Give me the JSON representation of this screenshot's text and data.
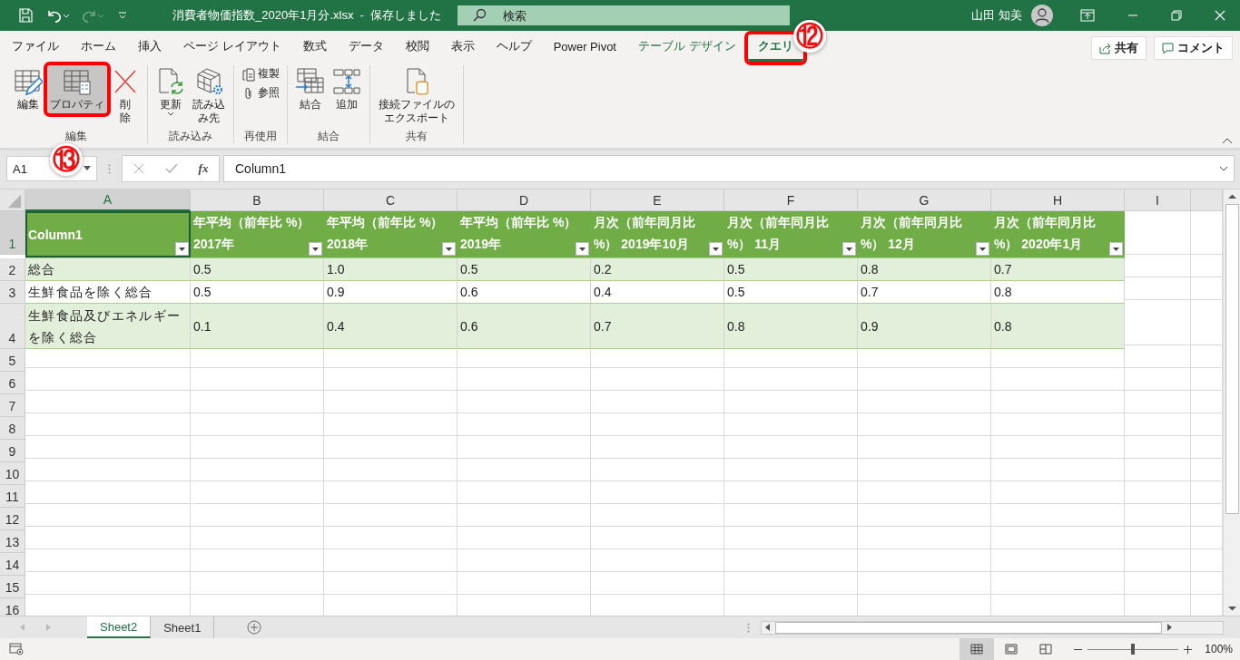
{
  "title_bar": {
    "title": "消費者物価指数_2020年1月分.xlsx  -  保存しました",
    "redo": {
      "disabled": true
    },
    "search": {
      "placeholder": "検索"
    },
    "user_name": "山田 知美"
  },
  "ribbon_tabs": [
    {
      "label": "ファイル",
      "selected": false,
      "contextual": false,
      "highlighted": false
    },
    {
      "label": "ホーム",
      "selected": false,
      "contextual": false,
      "highlighted": false
    },
    {
      "label": "挿入",
      "selected": false,
      "contextual": false,
      "highlighted": false
    },
    {
      "label": "ページ レイアウト",
      "selected": false,
      "contextual": false,
      "highlighted": false
    },
    {
      "label": "数式",
      "selected": false,
      "contextual": false,
      "highlighted": false
    },
    {
      "label": "データ",
      "selected": false,
      "contextual": false,
      "highlighted": false
    },
    {
      "label": "校閲",
      "selected": false,
      "contextual": false,
      "highlighted": false
    },
    {
      "label": "表示",
      "selected": false,
      "contextual": false,
      "highlighted": false
    },
    {
      "label": "ヘルプ",
      "selected": false,
      "contextual": false,
      "highlighted": false
    },
    {
      "label": "Power Pivot",
      "selected": false,
      "contextual": false,
      "highlighted": false
    },
    {
      "label": "テーブル デザイン",
      "selected": false,
      "contextual": true,
      "highlighted": false
    },
    {
      "label": "クエリ",
      "selected": true,
      "contextual": true,
      "highlighted": true
    }
  ],
  "share_button": "共有",
  "comment_button": "コメント",
  "ribbon_groups": [
    {
      "label": "編集",
      "items": [
        {
          "label": "編集",
          "kind": "large",
          "selected": false,
          "highlighted": false
        },
        {
          "label": "プロパティ",
          "kind": "large",
          "selected": true,
          "highlighted": true
        },
        {
          "label": "削除",
          "kind": "wrapped",
          "selected": false,
          "highlighted": false
        }
      ]
    },
    {
      "label": "読み込み",
      "items": [
        {
          "label": "更新",
          "kind": "split",
          "selected": false,
          "highlighted": false
        },
        {
          "label": "読み込み先",
          "kind": "wrapped",
          "selected": false,
          "highlighted": false
        }
      ]
    },
    {
      "label": "再使用",
      "items": [
        {
          "label": "複製",
          "kind": "small",
          "selected": false,
          "highlighted": false
        },
        {
          "label": "参照",
          "kind": "small",
          "selected": false,
          "highlighted": false
        }
      ]
    },
    {
      "label": "結合",
      "items": [
        {
          "label": "結合",
          "kind": "large",
          "selected": false,
          "highlighted": false
        },
        {
          "label": "追加",
          "kind": "large",
          "selected": false,
          "highlighted": false
        }
      ]
    },
    {
      "label": "共有",
      "items": [
        {
          "label": "接続ファイルのエクスポート",
          "kind": "wrapped",
          "selected": false,
          "highlighted": false
        }
      ]
    }
  ],
  "formula_bar": {
    "name_box": "A1",
    "function_button": "fx",
    "formula": "Column1"
  },
  "sheet": {
    "columns": [
      {
        "label": "A",
        "selected": true
      },
      {
        "label": "B",
        "selected": false
      },
      {
        "label": "C",
        "selected": false
      },
      {
        "label": "D",
        "selected": false
      },
      {
        "label": "E",
        "selected": false
      },
      {
        "label": "F",
        "selected": false
      },
      {
        "label": "G",
        "selected": false
      },
      {
        "label": "H",
        "selected": false
      },
      {
        "label": "I",
        "selected": false
      }
    ],
    "row_numbers": [
      {
        "label": "1",
        "selected": true
      },
      {
        "label": "2",
        "selected": false
      },
      {
        "label": "3",
        "selected": false
      },
      {
        "label": "4",
        "selected": false
      },
      {
        "label": "5",
        "selected": false
      },
      {
        "label": "6",
        "selected": false
      },
      {
        "label": "7",
        "selected": false
      },
      {
        "label": "8",
        "selected": false
      },
      {
        "label": "9",
        "selected": false
      },
      {
        "label": "10",
        "selected": false
      },
      {
        "label": "11",
        "selected": false
      },
      {
        "label": "12",
        "selected": false
      },
      {
        "label": "13",
        "selected": false
      },
      {
        "label": "14",
        "selected": false
      },
      {
        "label": "15",
        "selected": false
      },
      {
        "label": "16",
        "selected": false
      }
    ],
    "table": {
      "headers": [
        "Column1",
        "年平均（前年比 %）\n2017年",
        "年平均（前年比 %）\n2018年",
        "年平均（前年比 %）\n2019年",
        "月次（前年同月比\n%） 2019年10月",
        "月次（前年同月比\n%） 11月",
        "月次（前年同月比\n%） 12月",
        "月次（前年同月比\n%） 2020年1月"
      ],
      "rows": [
        [
          "総合",
          "0.5",
          "1.0",
          "0.5",
          "0.2",
          "0.5",
          "0.8",
          "0.7"
        ],
        [
          "生鮮食品を除く総合",
          "0.5",
          "0.9",
          "0.6",
          "0.4",
          "0.5",
          "0.7",
          "0.8"
        ],
        [
          "生鮮食品及びエネルギーを除く総合",
          "0.1",
          "0.4",
          "0.6",
          "0.7",
          "0.8",
          "0.9",
          "0.8"
        ]
      ]
    }
  },
  "sheet_tabs": [
    {
      "label": "Sheet2",
      "selected": true
    },
    {
      "label": "Sheet1",
      "selected": false
    }
  ],
  "status_bar": {
    "views": [
      {
        "selected": true
      },
      {
        "selected": false
      },
      {
        "selected": false
      }
    ],
    "zoom": {
      "level": 0.5,
      "reading": "100%"
    }
  },
  "annotations": [
    {
      "label": "⑫"
    },
    {
      "label": "⑬"
    }
  ]
}
